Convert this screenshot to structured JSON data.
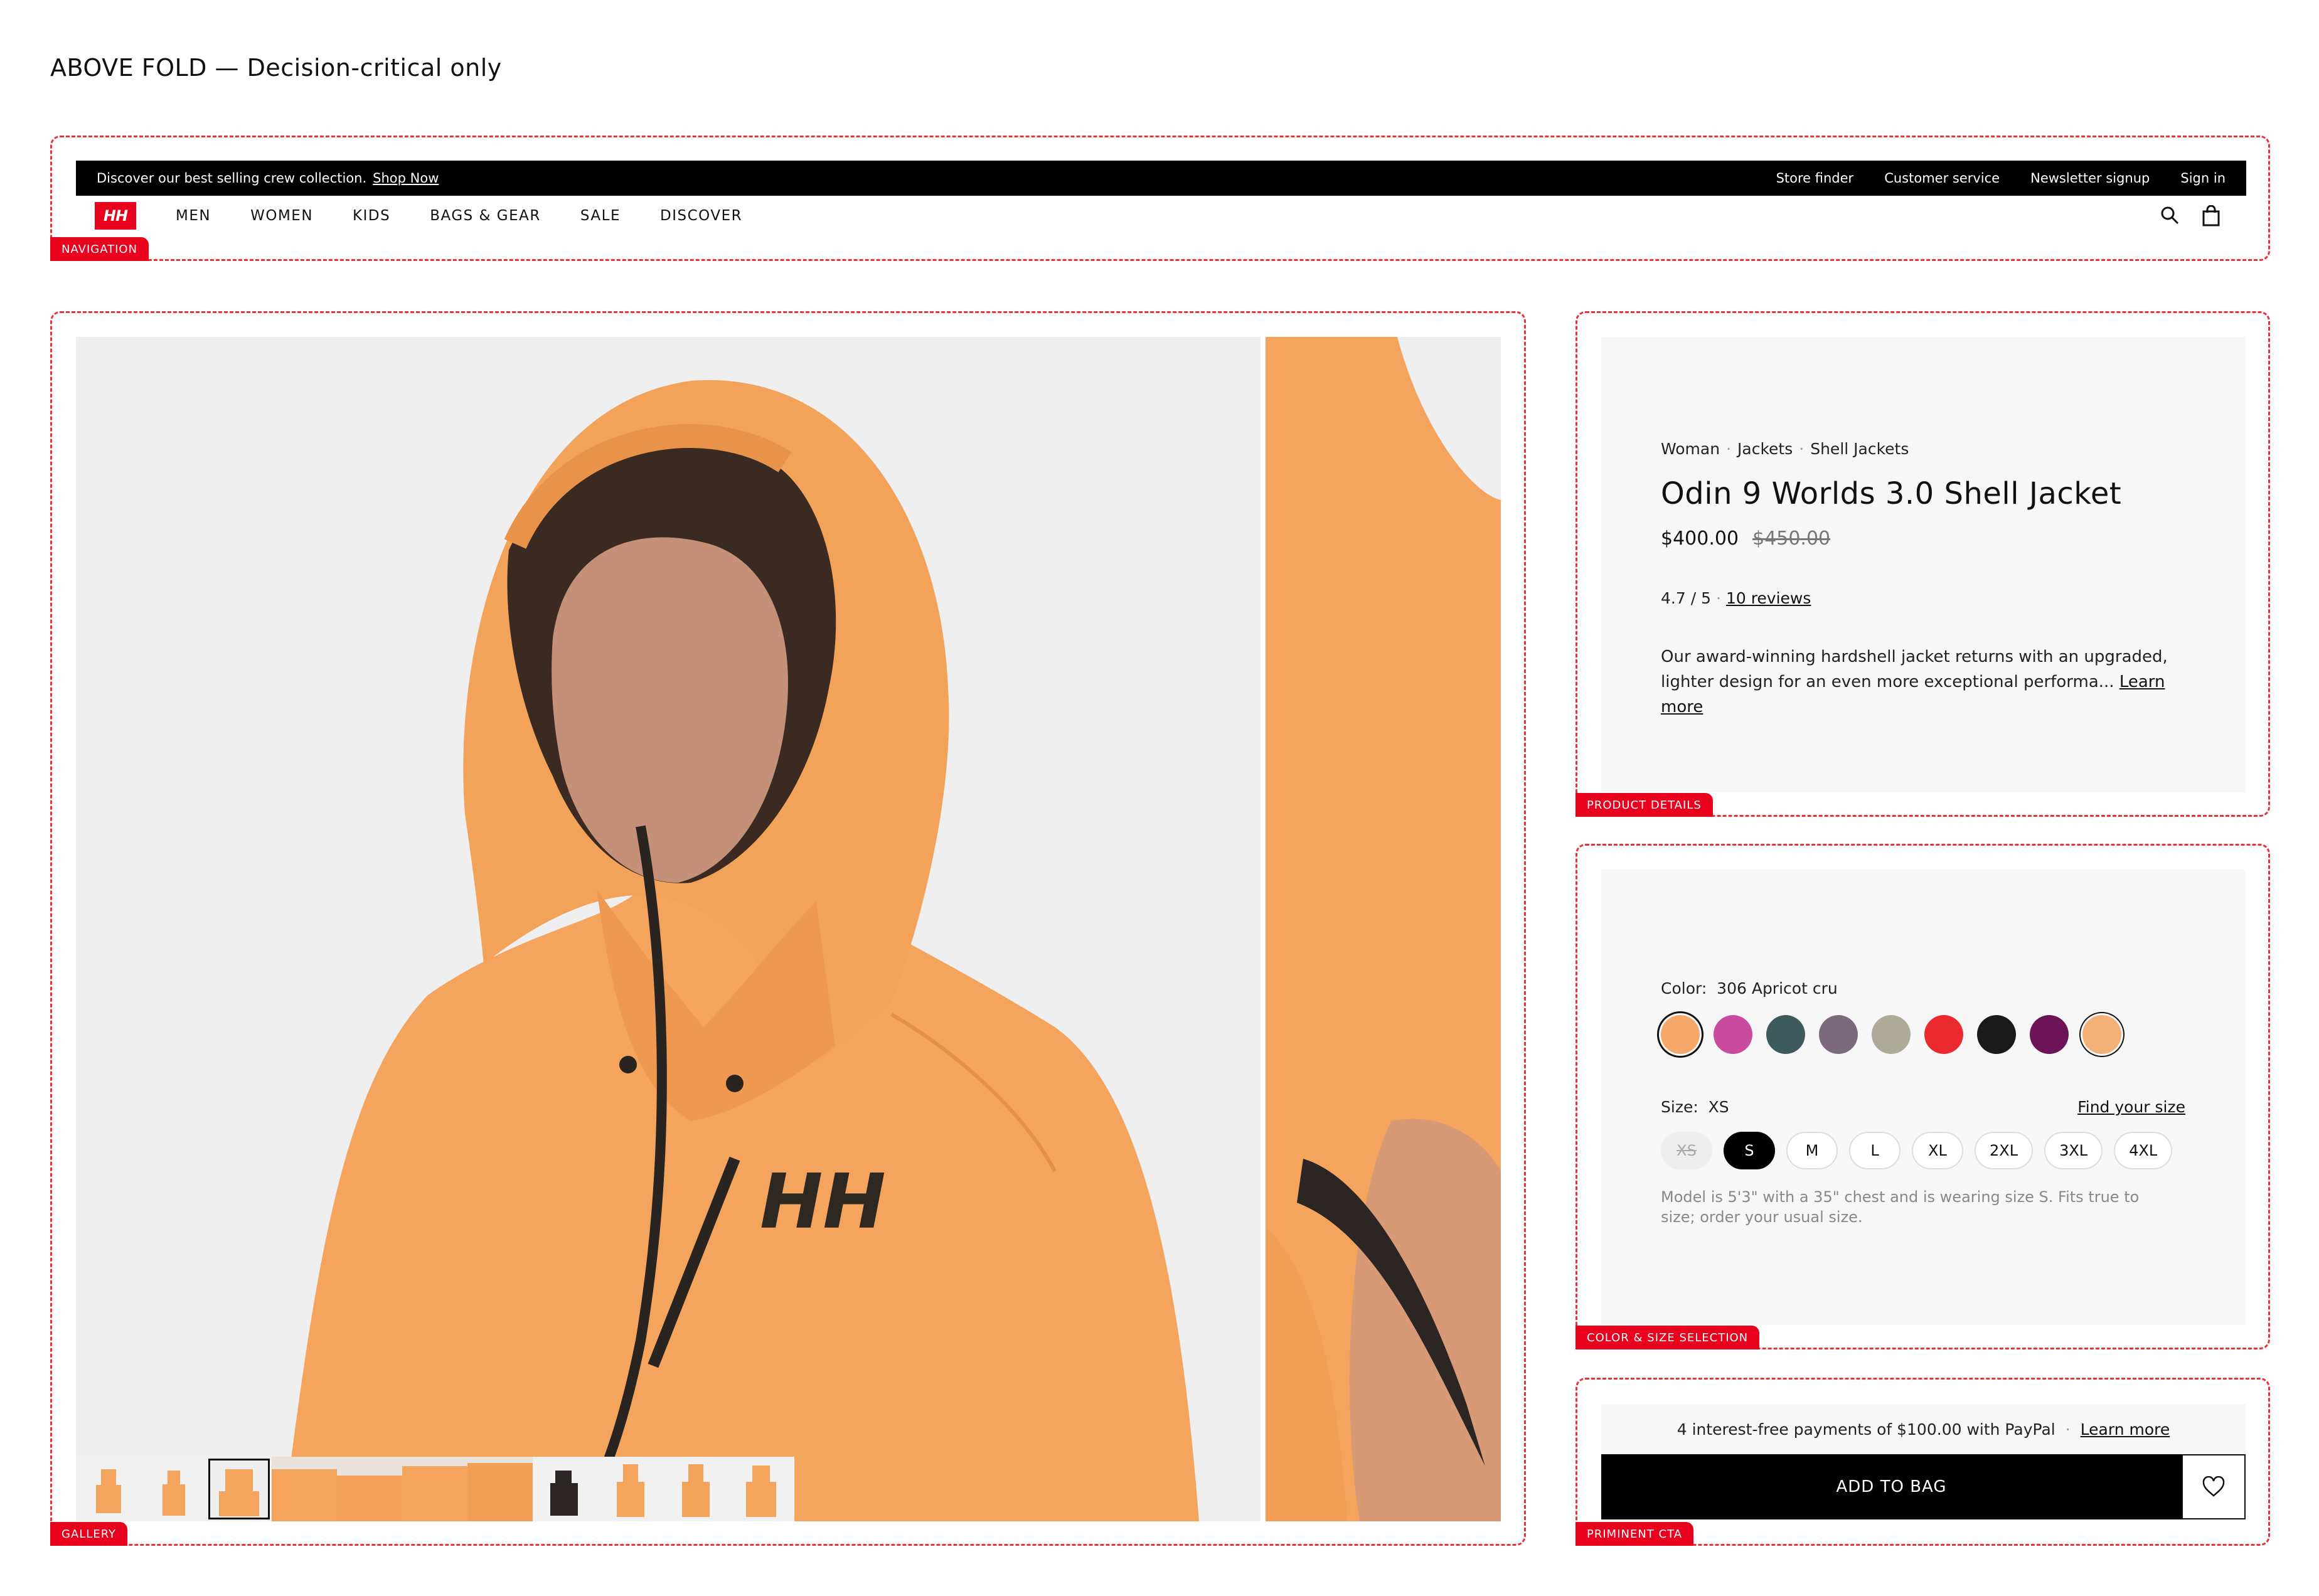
{
  "page_heading": "ABOVE FOLD — Decision-critical only",
  "zones": {
    "navigation": "NAVIGATION",
    "gallery": "GALLERY",
    "product_details": "PRODUCT DETAILS",
    "color_size": "COLOR & SIZE SELECTION",
    "cta": "PRIMINENT CTA"
  },
  "promo": {
    "text": "Discover our best selling crew collection.",
    "link": "Shop Now"
  },
  "utility_links": [
    "Store finder",
    "Customer service",
    "Newsletter signup",
    "Sign in"
  ],
  "logo": "HH",
  "nav_items": [
    "MEN",
    "WOMEN",
    "KIDS",
    "BAGS & GEAR",
    "SALE",
    "DISCOVER"
  ],
  "icons": {
    "search": "search-icon",
    "bag": "shopping-bag-icon",
    "wishlist": "heart-icon"
  },
  "product": {
    "breadcrumb": [
      "Woman",
      "Jackets",
      "Shell Jackets"
    ],
    "title": "Odin 9 Worlds 3.0 Shell Jacket",
    "price": "$400.00",
    "original_price": "$450.00",
    "rating": "4.7 / 5",
    "reviews_link": "10 reviews",
    "description": "Our award-winning hardshell jacket returns with an upgraded, lighter design for an even more exceptional performa...",
    "learn_more": "Learn more"
  },
  "color": {
    "label": "Color:",
    "selected": "306 Apricot cru",
    "swatches": [
      "#f5a86a",
      "#c94ba0",
      "#3f5a5c",
      "#7a6a7c",
      "#aeaa98",
      "#ea2a2e",
      "#1a1a1a",
      "#6c1457",
      "#f3b077"
    ]
  },
  "size": {
    "label": "Size:",
    "selected": "XS",
    "find_size": "Find your size",
    "options": [
      "XS",
      "S",
      "M",
      "L",
      "XL",
      "2XL",
      "3XL",
      "4XL"
    ],
    "fit_note": "Model is 5'3\" with a 35\" chest and is wearing size S. Fits true to size; order your usual size."
  },
  "cta": {
    "paypal_text": "4 interest-free payments of $100.00 with PayPal",
    "paypal_link": "Learn more",
    "add_to_bag": "ADD TO BAG"
  },
  "gallery": {
    "thumbnail_count": 11,
    "active_thumbnail": 3
  },
  "colors": {
    "accent_red": "#e8001c",
    "jacket_orange": "#f5a45d",
    "black": "#000000"
  }
}
